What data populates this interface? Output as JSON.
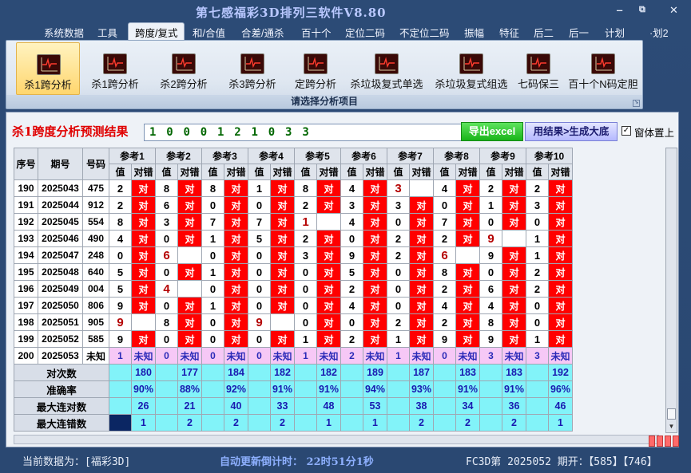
{
  "window": {
    "title": "第七感福彩3D排列三软件V8.80",
    "minimize": "‒",
    "maximize": "⧉",
    "close": "✕"
  },
  "menu": [
    {
      "label": "系统数据",
      "active": false
    },
    {
      "label": "工具",
      "active": false
    },
    {
      "label": "跨度/复式",
      "active": true
    },
    {
      "label": "和/合值",
      "active": false
    },
    {
      "label": "合差/通杀",
      "active": false
    },
    {
      "label": "百十个",
      "active": false
    },
    {
      "label": "定位二码",
      "active": false
    },
    {
      "label": "不定位二码",
      "active": false
    },
    {
      "label": "振幅",
      "active": false
    },
    {
      "label": "特征",
      "active": false
    },
    {
      "label": "后二",
      "active": false
    },
    {
      "label": "后一",
      "active": false
    },
    {
      "label": "计划",
      "active": false
    },
    {
      "label": "·划2",
      "active": false
    }
  ],
  "ribbon": {
    "tools": [
      {
        "label": "杀1跨分析",
        "active": true
      },
      {
        "label": "杀1跨分析",
        "active": false
      },
      {
        "label": "杀2跨分析",
        "active": false
      },
      {
        "label": "杀3跨分析",
        "active": false
      },
      {
        "label": "定跨分析",
        "active": false
      },
      {
        "label": "杀垃圾复式单选",
        "active": false
      },
      {
        "label": "杀垃圾复式组选",
        "active": false
      },
      {
        "label": "七码保三",
        "active": false
      },
      {
        "label": "百十个N码定胆",
        "active": false
      }
    ],
    "caption": "请选择分析项目",
    "icon": "chart-line-icon"
  },
  "result": {
    "label": "杀1跨度分析预测结果",
    "value": "1 0 0 0 1 2 1 0 3 3",
    "export_button": "导出excel",
    "generate_button": "用结果>生成大底",
    "topmost_checked": true,
    "topmost_label": "窗体置上"
  },
  "table": {
    "headers": {
      "seq": "序号",
      "period": "期号",
      "code": "号码"
    },
    "ref_headers": [
      "参考1",
      "参考2",
      "参考3",
      "参考4",
      "参考5",
      "参考6",
      "参考7",
      "参考8",
      "参考9",
      "参考10"
    ],
    "sub_value": "值",
    "sub_result": "对错",
    "ok_text": "对",
    "rows": [
      {
        "seq": "190",
        "period": "2025043",
        "code": "475",
        "vals": [
          "2",
          "8",
          "8",
          "1",
          "8",
          "4",
          "3",
          "4",
          "2",
          "2"
        ],
        "ok": [
          true,
          true,
          true,
          true,
          true,
          true,
          false,
          true,
          true,
          true
        ]
      },
      {
        "seq": "191",
        "period": "2025044",
        "code": "912",
        "vals": [
          "2",
          "6",
          "0",
          "0",
          "2",
          "3",
          "3",
          "0",
          "1",
          "3"
        ],
        "ok": [
          true,
          true,
          true,
          true,
          true,
          true,
          true,
          true,
          true,
          true
        ]
      },
      {
        "seq": "192",
        "period": "2025045",
        "code": "554",
        "vals": [
          "8",
          "3",
          "7",
          "7",
          "1",
          "4",
          "0",
          "7",
          "0",
          "0"
        ],
        "ok": [
          true,
          true,
          true,
          true,
          false,
          true,
          true,
          true,
          true,
          true
        ]
      },
      {
        "seq": "193",
        "period": "2025046",
        "code": "490",
        "vals": [
          "4",
          "0",
          "1",
          "5",
          "2",
          "0",
          "2",
          "2",
          "9",
          "1"
        ],
        "ok": [
          true,
          true,
          true,
          true,
          true,
          true,
          true,
          true,
          false,
          true
        ]
      },
      {
        "seq": "194",
        "period": "2025047",
        "code": "248",
        "vals": [
          "0",
          "6",
          "0",
          "0",
          "3",
          "9",
          "2",
          "6",
          "9",
          "1"
        ],
        "ok": [
          true,
          false,
          true,
          true,
          true,
          true,
          true,
          false,
          true,
          true
        ]
      },
      {
        "seq": "195",
        "period": "2025048",
        "code": "640",
        "vals": [
          "5",
          "0",
          "1",
          "0",
          "0",
          "5",
          "0",
          "8",
          "0",
          "2"
        ],
        "ok": [
          true,
          true,
          true,
          true,
          true,
          true,
          true,
          true,
          true,
          true
        ]
      },
      {
        "seq": "196",
        "period": "2025049",
        "code": "004",
        "vals": [
          "5",
          "4",
          "0",
          "0",
          "0",
          "2",
          "0",
          "2",
          "6",
          "2"
        ],
        "ok": [
          true,
          false,
          true,
          true,
          true,
          true,
          true,
          true,
          true,
          true
        ]
      },
      {
        "seq": "197",
        "period": "2025050",
        "code": "806",
        "vals": [
          "9",
          "0",
          "1",
          "0",
          "0",
          "4",
          "0",
          "4",
          "4",
          "0"
        ],
        "ok": [
          true,
          true,
          true,
          true,
          true,
          true,
          true,
          true,
          true,
          true
        ]
      },
      {
        "seq": "198",
        "period": "2025051",
        "code": "905",
        "vals": [
          "9",
          "8",
          "0",
          "9",
          "0",
          "0",
          "2",
          "2",
          "8",
          "0"
        ],
        "ok": [
          false,
          true,
          true,
          false,
          true,
          true,
          true,
          true,
          true,
          true
        ]
      },
      {
        "seq": "199",
        "period": "2025052",
        "code": "585",
        "vals": [
          "9",
          "0",
          "0",
          "0",
          "1",
          "2",
          "1",
          "9",
          "9",
          "1"
        ],
        "ok": [
          true,
          true,
          true,
          true,
          true,
          true,
          true,
          true,
          true,
          true
        ]
      }
    ],
    "prediction": {
      "seq": "200",
      "period": "2025053",
      "code": "未知",
      "vals": [
        "1",
        "0",
        "0",
        "0",
        "1",
        "2",
        "1",
        "0",
        "3",
        "3"
      ],
      "result": "未知"
    },
    "stats": [
      {
        "label": "对次数",
        "values": [
          "180",
          "177",
          "184",
          "182",
          "182",
          "189",
          "187",
          "183",
          "183",
          "192"
        ]
      },
      {
        "label": "准确率",
        "values": [
          "90%",
          "88%",
          "92%",
          "91%",
          "91%",
          "94%",
          "93%",
          "91%",
          "91%",
          "96%"
        ]
      },
      {
        "label": "最大连对数",
        "values": [
          "26",
          "21",
          "40",
          "33",
          "48",
          "53",
          "38",
          "34",
          "36",
          "46"
        ]
      },
      {
        "label": "最大连错数",
        "values": [
          "1",
          "2",
          "2",
          "2",
          "1",
          "1",
          "2",
          "2",
          "2",
          "1"
        ]
      }
    ]
  },
  "status": {
    "current_data": "当前数据为：[福彩3D]",
    "countdown": "自动更新倒计时：  22时51分1秒",
    "draw_info": "FC3D第 2025052 期开：【585】【746】"
  }
}
